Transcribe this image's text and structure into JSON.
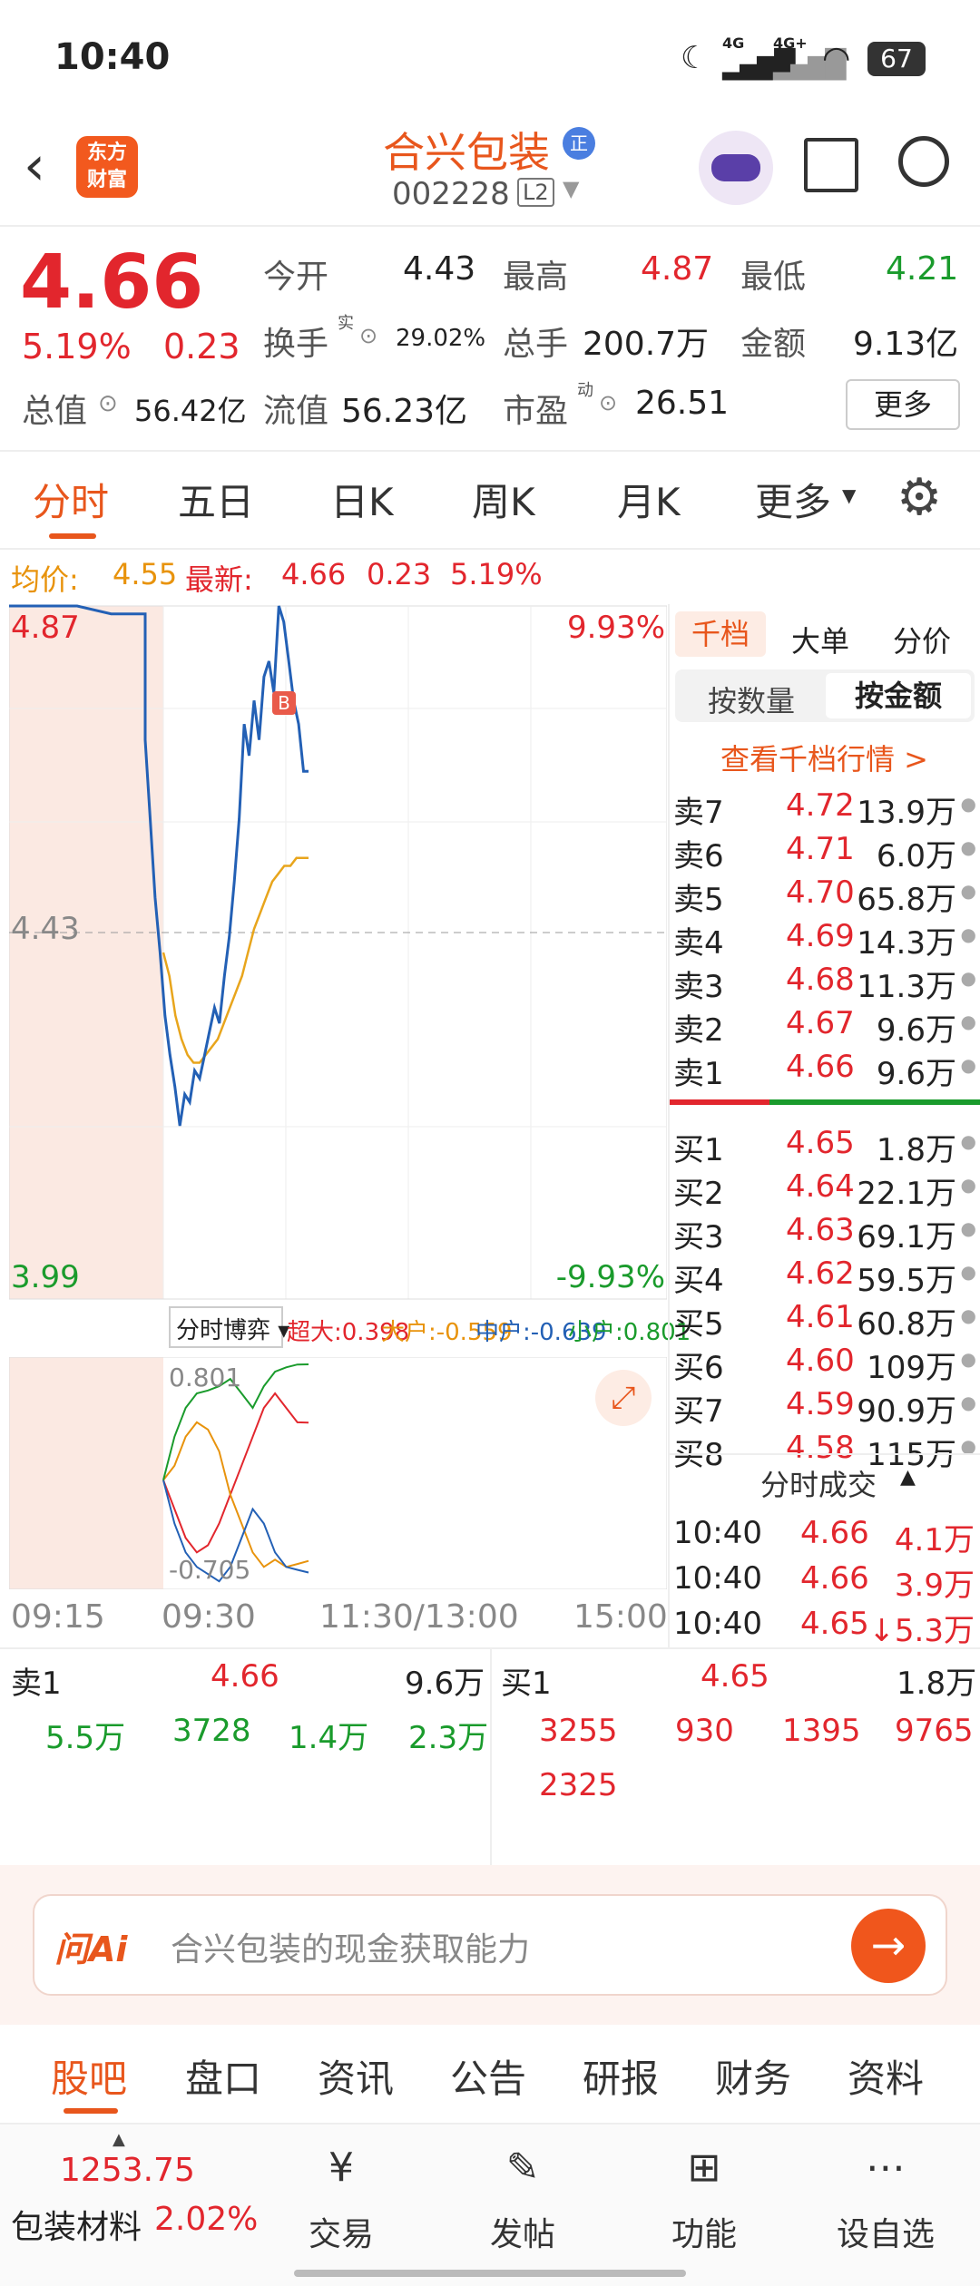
{
  "status": {
    "time": "10:40",
    "net1": "4G",
    "net2": "4G+",
    "battery": "67"
  },
  "header": {
    "stock_name": "合兴包装",
    "stock_code": "002228",
    "level": "L2",
    "badge": "正",
    "logo_line1": "东方",
    "logo_line2": "财富"
  },
  "quote": {
    "price": "4.66",
    "change_pct": "5.19%",
    "change": "0.23",
    "open_label": "今开",
    "open": "4.43",
    "high_label": "最高",
    "high": "4.87",
    "low_label": "最低",
    "low": "4.21",
    "turnover_label": "换手",
    "turnover_sup": "实",
    "turnover": "29.02%",
    "volume_label": "总手",
    "volume": "200.7万",
    "amount_label": "金额",
    "amount": "9.13亿",
    "mcap_label": "总值",
    "mcap": "56.42亿",
    "float_label": "流值",
    "float": "56.23亿",
    "pe_label": "市盈",
    "pe_sup": "动",
    "pe": "26.51",
    "more": "更多"
  },
  "tabs": [
    "分时",
    "五日",
    "日K",
    "周K",
    "月K",
    "更多"
  ],
  "avg": {
    "avg_label": "均价:",
    "avg": "4.55",
    "latest_label": "最新:",
    "latest": "4.66",
    "chg": "0.23",
    "pct": "5.19%"
  },
  "chart_data": {
    "type": "line",
    "y_top": "4.87",
    "y_mid": "4.43",
    "y_bottom": "3.99",
    "pct_top": "9.93%",
    "pct_bottom": "-9.93%",
    "x_labels": [
      "09:15",
      "09:30",
      "11:30/13:00",
      "15:00"
    ],
    "price": [
      4.87,
      4.87,
      4.87,
      4.86,
      4.86,
      4.7,
      4.6,
      4.5,
      4.43,
      4.35,
      4.3,
      4.26,
      4.21,
      4.25,
      4.24,
      4.28,
      4.27,
      4.3,
      4.33,
      4.36,
      4.34,
      4.4,
      4.45,
      4.52,
      4.6,
      4.72,
      4.68,
      4.75,
      4.7,
      4.78,
      4.8,
      4.76,
      4.87,
      4.85,
      4.8,
      4.75,
      4.72,
      4.66,
      4.66
    ],
    "avg": [
      4.43,
      4.4,
      4.35,
      4.32,
      4.3,
      4.29,
      4.29,
      4.3,
      4.31,
      4.32,
      4.34,
      4.36,
      4.38,
      4.4,
      4.43,
      4.46,
      4.48,
      4.5,
      4.52,
      4.53,
      4.54,
      4.54,
      4.55,
      4.55,
      4.55
    ],
    "indicator_title": "分时博弈",
    "super": "超大:0.398",
    "big": "大户:-0.559",
    "mid": "中户:-0.639",
    "small": "小户:0.801",
    "ind_top": "0.801",
    "ind_bottom": "-0.705",
    "super_series": [
      0,
      -0.2,
      -0.4,
      -0.5,
      -0.45,
      -0.3,
      -0.1,
      0.1,
      0.3,
      0.5,
      0.6,
      0.5,
      0.4,
      0.398
    ],
    "big_series": [
      0,
      0.1,
      0.3,
      0.4,
      0.35,
      0.2,
      -0.1,
      -0.3,
      -0.5,
      -0.6,
      -0.55,
      -0.6,
      -0.58,
      -0.559
    ],
    "mid_series": [
      0,
      -0.3,
      -0.5,
      -0.6,
      -0.65,
      -0.7,
      -0.6,
      -0.4,
      -0.2,
      -0.3,
      -0.5,
      -0.6,
      -0.62,
      -0.639
    ],
    "small_series": [
      0,
      0.3,
      0.5,
      0.6,
      0.62,
      0.65,
      0.7,
      0.6,
      0.5,
      0.65,
      0.75,
      0.78,
      0.8,
      0.801
    ]
  },
  "orderbook": {
    "tab1": "千档",
    "tab2": "大单",
    "tab3": "分价",
    "sub1": "按数量",
    "sub2": "按金额",
    "link": "查看千档行情 >",
    "asks": [
      {
        "l": "卖7",
        "p": "4.72",
        "v": "13.9万"
      },
      {
        "l": "卖6",
        "p": "4.71",
        "v": "6.0万"
      },
      {
        "l": "卖5",
        "p": "4.70",
        "v": "65.8万"
      },
      {
        "l": "卖4",
        "p": "4.69",
        "v": "14.3万"
      },
      {
        "l": "卖3",
        "p": "4.68",
        "v": "11.3万"
      },
      {
        "l": "卖2",
        "p": "4.67",
        "v": "9.6万"
      },
      {
        "l": "卖1",
        "p": "4.66",
        "v": "9.6万"
      }
    ],
    "bids": [
      {
        "l": "买1",
        "p": "4.65",
        "v": "1.8万"
      },
      {
        "l": "买2",
        "p": "4.64",
        "v": "22.1万"
      },
      {
        "l": "买3",
        "p": "4.63",
        "v": "69.1万"
      },
      {
        "l": "买4",
        "p": "4.62",
        "v": "59.5万"
      },
      {
        "l": "买5",
        "p": "4.61",
        "v": "60.8万"
      },
      {
        "l": "买6",
        "p": "4.60",
        "v": "109万"
      },
      {
        "l": "买7",
        "p": "4.59",
        "v": "90.9万"
      },
      {
        "l": "买8",
        "p": "4.58",
        "v": "115万"
      }
    ],
    "trades_title": "分时成交",
    "trades": [
      {
        "t": "10:40",
        "p": "4.66",
        "v": "4.1万"
      },
      {
        "t": "10:40",
        "p": "4.66",
        "v": "3.9万"
      },
      {
        "t": "10:40",
        "p": "4.65",
        "v": "↓5.3万"
      }
    ]
  },
  "level2": {
    "sell_label": "卖1",
    "sell_price": "4.66",
    "sell_vol": "9.6万",
    "buy_label": "买1",
    "buy_price": "4.65",
    "buy_vol": "1.8万",
    "sell_orders": [
      "5.5万",
      "3728",
      "1.4万",
      "2.3万"
    ],
    "buy_orders": [
      "3255",
      "930",
      "1395",
      "9765",
      "2325"
    ]
  },
  "ai": {
    "logo": "问Ai",
    "placeholder": "合兴包装的现金获取能力"
  },
  "news_tabs": [
    "股吧",
    "盘口",
    "资讯",
    "公告",
    "研报",
    "财务",
    "资料"
  ],
  "bottom": {
    "index_value": "1253.75",
    "index_name": "包装材料",
    "index_pct": "2.02%",
    "trade": "交易",
    "post": "发帖",
    "func": "功能",
    "watch": "设自选"
  }
}
